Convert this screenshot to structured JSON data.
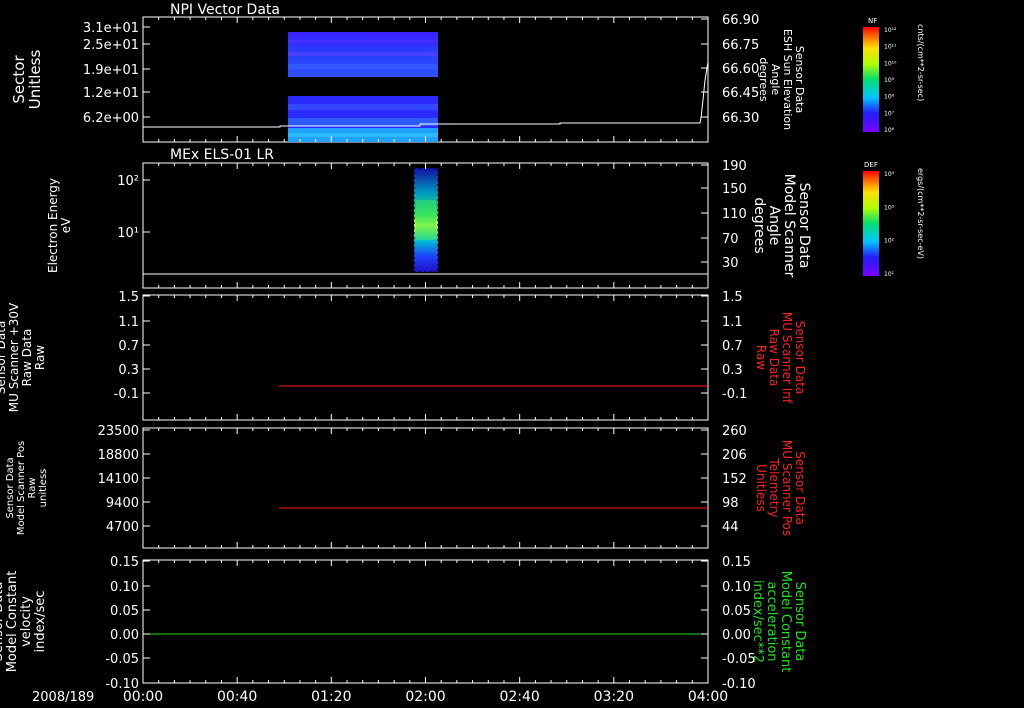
{
  "date_label": "2008/189",
  "time_ticks": [
    "00:00",
    "00:40",
    "01:20",
    "02:00",
    "02:40",
    "03:20",
    "04:00"
  ],
  "colors": {
    "background": "#000000",
    "axes": "#ffffff",
    "red": "#ff2020",
    "green": "#20e020"
  },
  "chart_data": [
    {
      "type": "heatmap",
      "title": "NPI Vector Data",
      "ylabel": [
        "Sector",
        "Unitless"
      ],
      "yticks": [
        "3.1e+01",
        "2.5e+01",
        "1.9e+01",
        "1.2e+01",
        "6.2e+00"
      ],
      "y2label": [
        "Sensor Data",
        "ESH Sun Elevation",
        "Angle",
        "degrees"
      ],
      "y2ticks": [
        "66.90",
        "66.75",
        "66.60",
        "66.45",
        "66.30"
      ],
      "data_time_range": [
        "01:05",
        "02:02"
      ],
      "colorbar": {
        "label": "NF",
        "units": "cnts/(cm**2-sr-sec)",
        "ticks": [
          "10¹²",
          "10¹¹",
          "10¹⁰",
          "10⁹",
          "10⁸",
          "10⁷",
          "10⁶"
        ]
      }
    },
    {
      "type": "heatmap",
      "title": "MEx ELS-01 LR",
      "ylabel": [
        "Electron Energy",
        "eV"
      ],
      "yticks": [
        "10²",
        "10¹"
      ],
      "y2label": [
        "Sensor Data",
        "Model Scanner",
        "Angle",
        "degrees"
      ],
      "y2ticks": [
        "190",
        "150",
        "110",
        "70",
        "30"
      ],
      "data_time_range": [
        "01:55",
        "02:05"
      ],
      "colorbar": {
        "label": "DEF",
        "units": "ergs/(cm**2-sr-sec-eV)",
        "ticks": [
          "10⁴",
          "10³",
          "10²",
          "10¹"
        ]
      }
    },
    {
      "type": "line",
      "ylabel": [
        "Sensor Data",
        "MU Scanner +30V",
        "Raw Data",
        "Raw"
      ],
      "yticks": [
        "1.5",
        "1.1",
        "0.7",
        "0.3",
        "-0.1"
      ],
      "y2label": [
        "Sensor Data",
        "MU Scanner Inf",
        "Raw Data",
        "Raw"
      ],
      "y2ticks": [
        "1.5",
        "1.1",
        "0.7",
        "0.3",
        "-0.1"
      ],
      "ylim": [
        -0.3,
        1.5
      ],
      "series": [
        {
          "x": [
            "01:03",
            "04:00"
          ],
          "values": [
            0.0,
            0.0
          ]
        }
      ]
    },
    {
      "type": "line",
      "ylabel": [
        "Sensor Data",
        "Model Scanner Pos",
        "Raw",
        "unitless"
      ],
      "yticks": [
        "23500",
        "18800",
        "14100",
        "9400",
        "4700"
      ],
      "y2label": [
        "Sensor Data",
        "MU Scanner Pos",
        "Telemetry",
        "Unitless"
      ],
      "y2ticks": [
        "260",
        "206",
        "152",
        "98",
        "44"
      ],
      "ylim": [
        0,
        23500
      ],
      "series": [
        {
          "x": [
            "01:03",
            "04:00"
          ],
          "values": [
            7000,
            7000
          ]
        }
      ]
    },
    {
      "type": "line",
      "ylabel": [
        "Sensor Data",
        "Model Constant",
        "velocity",
        "index/sec"
      ],
      "yticks": [
        "0.15",
        "0.10",
        "0.05",
        "0.00",
        "-0.05",
        "-0.10"
      ],
      "y2label": [
        "Sensor Data",
        "Model Constant",
        "acceleration",
        "index/sec**2"
      ],
      "y2ticks": [
        "0.15",
        "0.10",
        "0.05",
        "0.00",
        "-0.05",
        "-0.10"
      ],
      "ylim": [
        -0.1,
        0.15
      ],
      "series": [
        {
          "x": [
            "00:00",
            "04:00"
          ],
          "values": [
            0.0,
            0.0
          ]
        }
      ]
    }
  ]
}
